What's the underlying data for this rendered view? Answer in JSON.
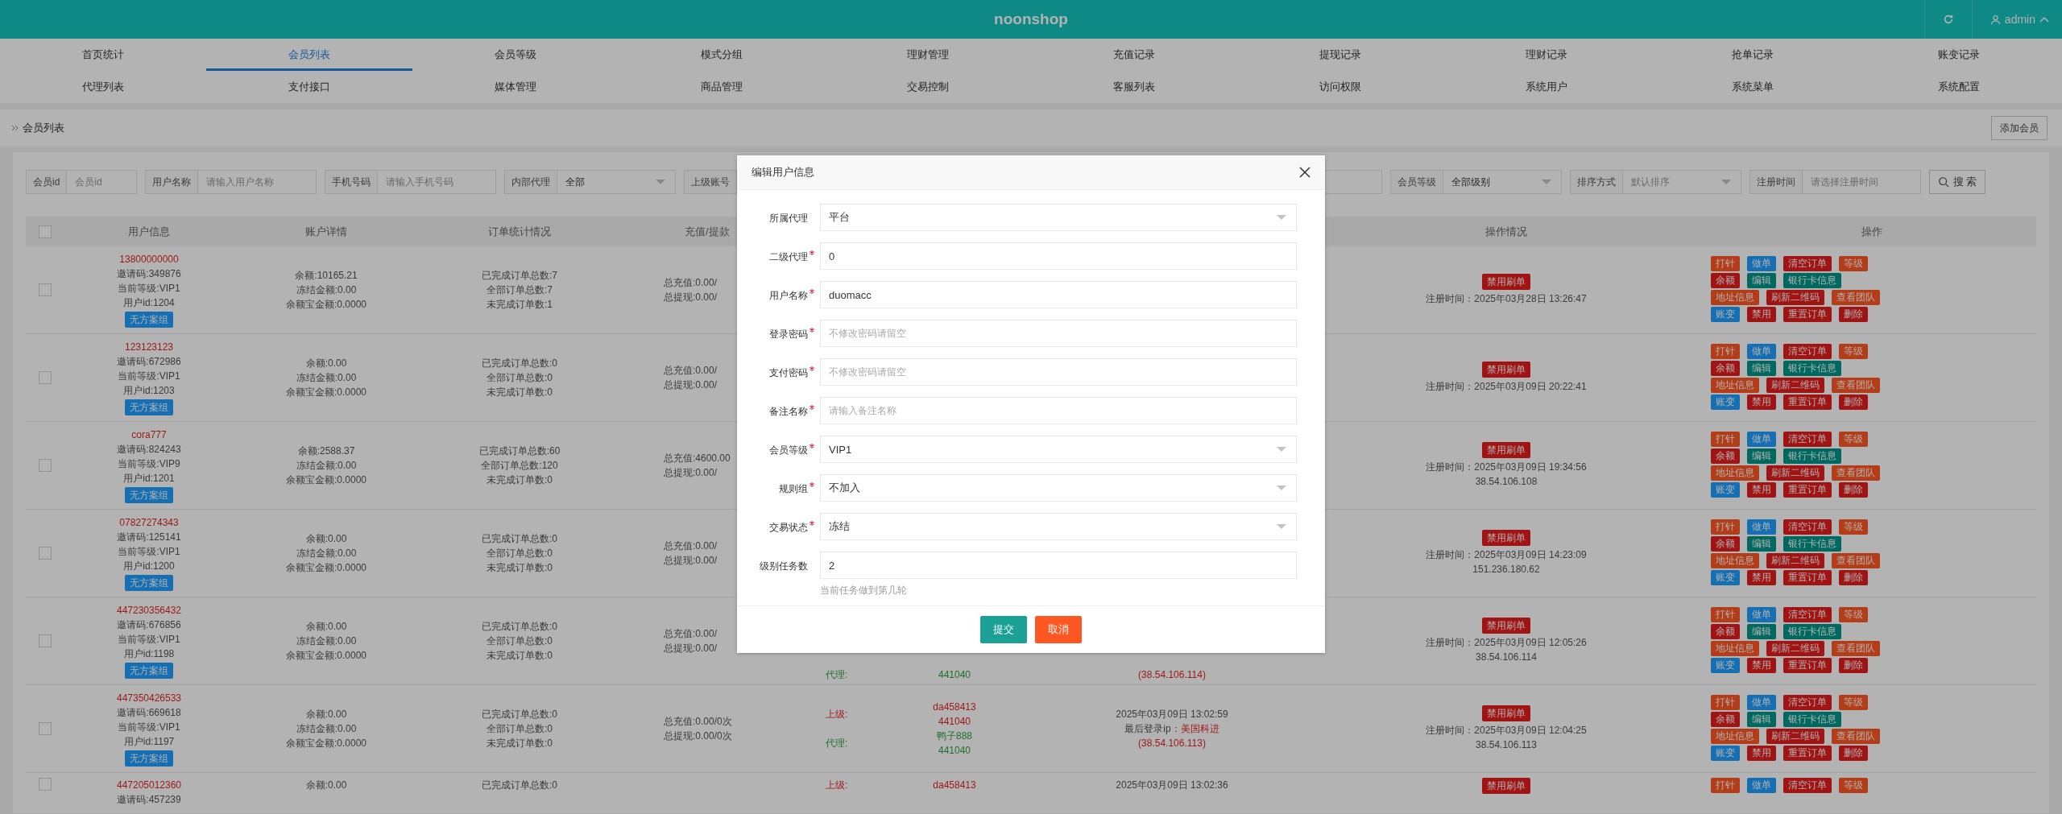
{
  "header": {
    "brand": "noonshop",
    "user": "admin"
  },
  "nav": [
    {
      "items": [
        {
          "label": "首页统计",
          "selected": false
        },
        {
          "label": "会员列表",
          "selected": true
        },
        {
          "label": "会员等级",
          "selected": false
        },
        {
          "label": "模式分组",
          "selected": false
        },
        {
          "label": "理财管理",
          "selected": false
        },
        {
          "label": "充值记录",
          "selected": false
        },
        {
          "label": "提现记录",
          "selected": false
        },
        {
          "label": "理财记录",
          "selected": false
        },
        {
          "label": "抢单记录",
          "selected": false
        },
        {
          "label": "账变记录",
          "selected": false
        }
      ]
    },
    {
      "items": [
        {
          "label": "代理列表",
          "selected": false
        },
        {
          "label": "支付接口",
          "selected": false
        },
        {
          "label": "媒体管理",
          "selected": false
        },
        {
          "label": "商品管理",
          "selected": false
        },
        {
          "label": "交易控制",
          "selected": false
        },
        {
          "label": "客服列表",
          "selected": false
        },
        {
          "label": "访问权限",
          "selected": false
        },
        {
          "label": "系统用户",
          "selected": false
        },
        {
          "label": "系统菜单",
          "selected": false
        },
        {
          "label": "系统配置",
          "selected": false
        }
      ]
    }
  ],
  "breadcrumb": {
    "title": "会员列表",
    "button": "添加会员"
  },
  "filters": [
    {
      "label": "会员id",
      "kind": "input",
      "placeholder": "会员id"
    },
    {
      "label": "用户名称",
      "kind": "input",
      "placeholder": "请输入用户名称"
    },
    {
      "label": "手机号码",
      "kind": "input",
      "placeholder": "请输入手机号码"
    },
    {
      "label": "内部代理",
      "kind": "select",
      "value": "全部"
    },
    {
      "label": "上级账号",
      "kind": "wide"
    },
    {
      "label": "会员等级",
      "kind": "select",
      "value": "全部级别"
    },
    {
      "label": "排序方式",
      "kind": "select",
      "placeholder": "默认排序"
    },
    {
      "label": "注册时间",
      "kind": "input",
      "placeholder": "请选择注册时间"
    }
  ],
  "search_button": "搜 索",
  "table": {
    "select_all": false,
    "columns": [
      {
        "label": "用户信息"
      },
      {
        "label": "账户详情"
      },
      {
        "label": "订单统计情况"
      },
      {
        "label": "充值/提款"
      },
      {},
      {},
      {
        "label": "操作情况"
      },
      {
        "label": "操作"
      }
    ],
    "rows": [
      {
        "kind": "full",
        "checked": false,
        "user": {
          "name": "13800000000",
          "lines": [
            "邀请码:349876",
            "当前等级:VIP1",
            "用户id:1204"
          ],
          "badge": "无方案组"
        },
        "account": [
          "余额:10165.21",
          "冻结金额:0.00",
          "余额宝金额:0.0000"
        ],
        "orders": [
          "已完成订单总数:7",
          "全部订单总数:7",
          "未完成订单数:1"
        ],
        "funds": [
          "总充值:0.00/",
          "总提现:0.00/"
        ],
        "superior": [],
        "login": {},
        "status": {
          "badge": "禁用刷单",
          "lines": [
            "注册时间：2025年03月28日 13:26:47"
          ]
        },
        "actions": [
          [
            {
              "label": "打针",
              "color": "#b33d18"
            },
            {
              "label": "做单",
              "color": "#156fb2"
            },
            {
              "label": "清空订单",
              "color": "#a01414"
            },
            {
              "label": "等级",
              "color": "#b33d18"
            }
          ],
          [
            {
              "label": "余额",
              "color": "#a01414"
            },
            {
              "label": "编辑",
              "color": "#00695f"
            },
            {
              "label": "银行卡信息",
              "color": "#00695f"
            }
          ],
          [
            {
              "label": "地址信息",
              "color": "#b33d18"
            },
            {
              "label": "刷新二维码",
              "color": "#a01414"
            },
            {
              "label": "查看团队",
              "color": "#b33d18"
            }
          ],
          [
            {
              "label": "账变",
              "color": "#156fb2"
            },
            {
              "label": "禁用",
              "color": "#a01414"
            },
            {
              "label": "重置订单",
              "color": "#a01414"
            },
            {
              "label": "删除",
              "color": "#a01414"
            }
          ]
        ]
      },
      {
        "kind": "full",
        "checked": false,
        "user": {
          "name": "123123123",
          "lines": [
            "邀请码:672986",
            "当前等级:VIP1",
            "用户id:1203"
          ],
          "badge": "无方案组"
        },
        "account": [
          "余额:0.00",
          "冻结金额:0.00",
          "余额宝金额:0.0000"
        ],
        "orders": [
          "已完成订单总数:0",
          "全部订单总数:0",
          "未完成订单数:0"
        ],
        "funds": [
          "总充值:0.00/",
          "总提现:0.00/"
        ],
        "superior": [],
        "login": {},
        "status": {
          "badge": "禁用刷单",
          "lines": [
            "注册时间：2025年03月09日 20:22:41"
          ]
        },
        "actions": [
          [
            {
              "label": "打针",
              "color": "#b33d18"
            },
            {
              "label": "做单",
              "color": "#156fb2"
            },
            {
              "label": "清空订单",
              "color": "#a01414"
            },
            {
              "label": "等级",
              "color": "#b33d18"
            }
          ],
          [
            {
              "label": "余额",
              "color": "#a01414"
            },
            {
              "label": "编辑",
              "color": "#00695f"
            },
            {
              "label": "银行卡信息",
              "color": "#00695f"
            }
          ],
          [
            {
              "label": "地址信息",
              "color": "#b33d18"
            },
            {
              "label": "刷新二维码",
              "color": "#a01414"
            },
            {
              "label": "查看团队",
              "color": "#b33d18"
            }
          ],
          [
            {
              "label": "账变",
              "color": "#156fb2"
            },
            {
              "label": "禁用",
              "color": "#a01414"
            },
            {
              "label": "重置订单",
              "color": "#a01414"
            },
            {
              "label": "删除",
              "color": "#a01414"
            }
          ]
        ]
      },
      {
        "kind": "full",
        "checked": false,
        "user": {
          "name": "cora777",
          "lines": [
            "邀请码:824243",
            "当前等级:VIP9",
            "用户id:1201"
          ],
          "badge": "无方案组"
        },
        "account": [
          "余额:2588.37",
          "冻结金额:0.00",
          "余额宝金额:0.0000"
        ],
        "orders": [
          "已完成订单总数:60",
          "全部订单总数:120",
          "未完成订单数:0"
        ],
        "funds": [
          "总充值:4600.00",
          "总提现:0.00/"
        ],
        "superior": [],
        "login": {},
        "status": {
          "badge": "禁用刷单",
          "lines": [
            "注册时间：2025年03月09日 19:34:56",
            "38.54.106.108"
          ]
        },
        "actions": [
          [
            {
              "label": "打针",
              "color": "#b33d18"
            },
            {
              "label": "做单",
              "color": "#156fb2"
            },
            {
              "label": "清空订单",
              "color": "#a01414"
            },
            {
              "label": "等级",
              "color": "#b33d18"
            }
          ],
          [
            {
              "label": "余额",
              "color": "#a01414"
            },
            {
              "label": "编辑",
              "color": "#00695f"
            },
            {
              "label": "银行卡信息",
              "color": "#00695f"
            }
          ],
          [
            {
              "label": "地址信息",
              "color": "#b33d18"
            },
            {
              "label": "刷新二维码",
              "color": "#a01414"
            },
            {
              "label": "查看团队",
              "color": "#b33d18"
            }
          ],
          [
            {
              "label": "账变",
              "color": "#156fb2"
            },
            {
              "label": "禁用",
              "color": "#a01414"
            },
            {
              "label": "重置订单",
              "color": "#a01414"
            },
            {
              "label": "删除",
              "color": "#a01414"
            }
          ]
        ]
      },
      {
        "kind": "full",
        "checked": false,
        "user": {
          "name": "07827274343",
          "lines": [
            "邀请码:125141",
            "当前等级:VIP1",
            "用户id:1200"
          ],
          "badge": "无方案组"
        },
        "account": [
          "余额:0.00",
          "冻结金额:0.00",
          "余额宝金额:0.0000"
        ],
        "orders": [
          "已完成订单总数:0",
          "全部订单总数:0",
          "未完成订单数:0"
        ],
        "funds": [
          "总充值:0.00/",
          "总提现:0.00/"
        ],
        "superior": [],
        "login": {},
        "status": {
          "badge": "禁用刷单",
          "lines": [
            "注册时间：2025年03月09日 14:23:09",
            "151.236.180.62"
          ]
        },
        "actions": [
          [
            {
              "label": "打针",
              "color": "#b33d18"
            },
            {
              "label": "做单",
              "color": "#156fb2"
            },
            {
              "label": "清空订单",
              "color": "#a01414"
            },
            {
              "label": "等级",
              "color": "#b33d18"
            }
          ],
          [
            {
              "label": "余额",
              "color": "#a01414"
            },
            {
              "label": "编辑",
              "color": "#00695f"
            },
            {
              "label": "银行卡信息",
              "color": "#00695f"
            }
          ],
          [
            {
              "label": "地址信息",
              "color": "#b33d18"
            },
            {
              "label": "刷新二维码",
              "color": "#a01414"
            },
            {
              "label": "查看团队",
              "color": "#b33d18"
            }
          ],
          [
            {
              "label": "账变",
              "color": "#156fb2"
            },
            {
              "label": "禁用",
              "color": "#a01414"
            },
            {
              "label": "重置订单",
              "color": "#a01414"
            },
            {
              "label": "删除",
              "color": "#a01414"
            }
          ]
        ]
      },
      {
        "kind": "covered",
        "checked": false,
        "user": {
          "name": "447230356432",
          "lines": [
            "邀请码:676856",
            "当前等级:VIP1",
            "用户id:1198"
          ],
          "badge": "无方案组"
        },
        "account": [
          "余额:0.00",
          "冻结金额:0.00",
          "余额宝金额:0.0000"
        ],
        "orders": [
          "已完成订单总数:0",
          "全部订单总数:0",
          "未完成订单数:0"
        ],
        "funds": [
          "总充值:0.00/",
          "总提现:0.00/"
        ],
        "superior": [
          {
            "kind": "agent",
            "label": "代理:",
            "values": [
              "441040"
            ]
          }
        ],
        "login": {
          "ip_addr": "(38.54.106.114)"
        },
        "status": {
          "badge": "禁用刷单",
          "lines": [
            "注册时间：2025年03月09日 12:05:26",
            "38.54.106.114"
          ]
        },
        "actions": [
          [
            {
              "label": "打针",
              "color": "#b33d18"
            },
            {
              "label": "做单",
              "color": "#156fb2"
            },
            {
              "label": "清空订单",
              "color": "#a01414"
            },
            {
              "label": "等级",
              "color": "#b33d18"
            }
          ],
          [
            {
              "label": "余额",
              "color": "#a01414"
            },
            {
              "label": "编辑",
              "color": "#00695f"
            },
            {
              "label": "银行卡信息",
              "color": "#00695f"
            }
          ],
          [
            {
              "label": "地址信息",
              "color": "#b33d18"
            },
            {
              "label": "刷新二维码",
              "color": "#a01414"
            },
            {
              "label": "查看团队",
              "color": "#b33d18"
            }
          ],
          [
            {
              "label": "账变",
              "color": "#156fb2"
            },
            {
              "label": "禁用",
              "color": "#a01414"
            },
            {
              "label": "重置订单",
              "color": "#a01414"
            },
            {
              "label": "删除",
              "color": "#a01414"
            }
          ]
        ]
      },
      {
        "kind": "full",
        "checked": false,
        "user": {
          "name": "447350426533",
          "lines": [
            "邀请码:669618",
            "当前等级:VIP1",
            "用户id:1197"
          ],
          "badge": "无方案组"
        },
        "account": [
          "余额:0.00",
          "冻结金额:0.00",
          "余额宝金额:0.0000"
        ],
        "orders": [
          "已完成订单总数:0",
          "全部订单总数:0",
          "未完成订单数:0"
        ],
        "funds": [
          "总充值:0.00/0次",
          "总提现:0.00/0次"
        ],
        "superior": [
          {
            "kind": "upline",
            "label": "上级:",
            "values": [
              "da458413",
              "441040"
            ]
          },
          {
            "kind": "agent",
            "label": "代理:",
            "values": [
              "鸭子888",
              "441040"
            ]
          }
        ],
        "login": {
          "time": "2025年03月09日 13:02:59",
          "ip_label": "最后登录ip：",
          "ip_place": "美国科进",
          "ip_addr": "(38.54.106.113)"
        },
        "status": {
          "badge": "禁用刷单",
          "lines": [
            "注册时间：2025年03月09日 12:04:25",
            "38.54.106.113"
          ]
        },
        "actions": [
          [
            {
              "label": "打针",
              "color": "#b33d18"
            },
            {
              "label": "做单",
              "color": "#156fb2"
            },
            {
              "label": "清空订单",
              "color": "#a01414"
            },
            {
              "label": "等级",
              "color": "#b33d18"
            }
          ],
          [
            {
              "label": "余额",
              "color": "#a01414"
            },
            {
              "label": "编辑",
              "color": "#00695f"
            },
            {
              "label": "银行卡信息",
              "color": "#00695f"
            }
          ],
          [
            {
              "label": "地址信息",
              "color": "#b33d18"
            },
            {
              "label": "刷新二维码",
              "color": "#a01414"
            },
            {
              "label": "查看团队",
              "color": "#b33d18"
            }
          ],
          [
            {
              "label": "账变",
              "color": "#156fb2"
            },
            {
              "label": "禁用",
              "color": "#a01414"
            },
            {
              "label": "重置订单",
              "color": "#a01414"
            },
            {
              "label": "删除",
              "color": "#a01414"
            }
          ]
        ]
      },
      {
        "kind": "cut",
        "checked": false,
        "user": {
          "name": "447205012360",
          "lines": [
            "邀请码:457239"
          ]
        },
        "account": [
          "余额:0.00"
        ],
        "orders": [
          "已完成订单总数:0"
        ],
        "superior": [
          {
            "kind": "upline",
            "label": "上级:",
            "values": [
              "da458413"
            ]
          }
        ],
        "login": {
          "time": "2025年03月09日 13:02:36"
        },
        "status": {
          "badge": "禁用刷单"
        },
        "actions": [
          [
            {
              "label": "打针",
              "color": "#b33d18"
            },
            {
              "label": "做单",
              "color": "#156fb2"
            },
            {
              "label": "清空订单",
              "color": "#a01414"
            },
            {
              "label": "等级",
              "color": "#b33d18"
            }
          ]
        ]
      }
    ]
  },
  "modal": {
    "title": "编辑用户信息",
    "fields": [
      {
        "label": "所属代理",
        "required": false,
        "kind": "select",
        "value": "平台"
      },
      {
        "label": "二级代理",
        "required": true,
        "kind": "input",
        "value": "0"
      },
      {
        "label": "用户名称",
        "required": true,
        "kind": "input",
        "value": "duomacc"
      },
      {
        "label": "登录密码",
        "required": true,
        "kind": "input",
        "placeholder": "不修改密码请留空"
      },
      {
        "label": "支付密码",
        "required": true,
        "kind": "input",
        "placeholder": "不修改密码请留空"
      },
      {
        "label": "备注名称",
        "required": true,
        "kind": "input",
        "placeholder": "请输入备注名称"
      },
      {
        "label": "会员等级",
        "required": true,
        "kind": "select",
        "value": "VIP1"
      },
      {
        "label": "规则组",
        "required": true,
        "kind": "select",
        "value": "不加入"
      },
      {
        "label": "交易状态",
        "required": true,
        "kind": "select",
        "value": "冻结"
      },
      {
        "label": "级别任务数",
        "required": false,
        "kind": "input",
        "value": "2",
        "hint": "当前任务做到第几轮"
      }
    ],
    "buttons": [
      {
        "label": "提交",
        "kind": "primary"
      },
      {
        "label": "取消",
        "kind": "danger"
      }
    ]
  }
}
